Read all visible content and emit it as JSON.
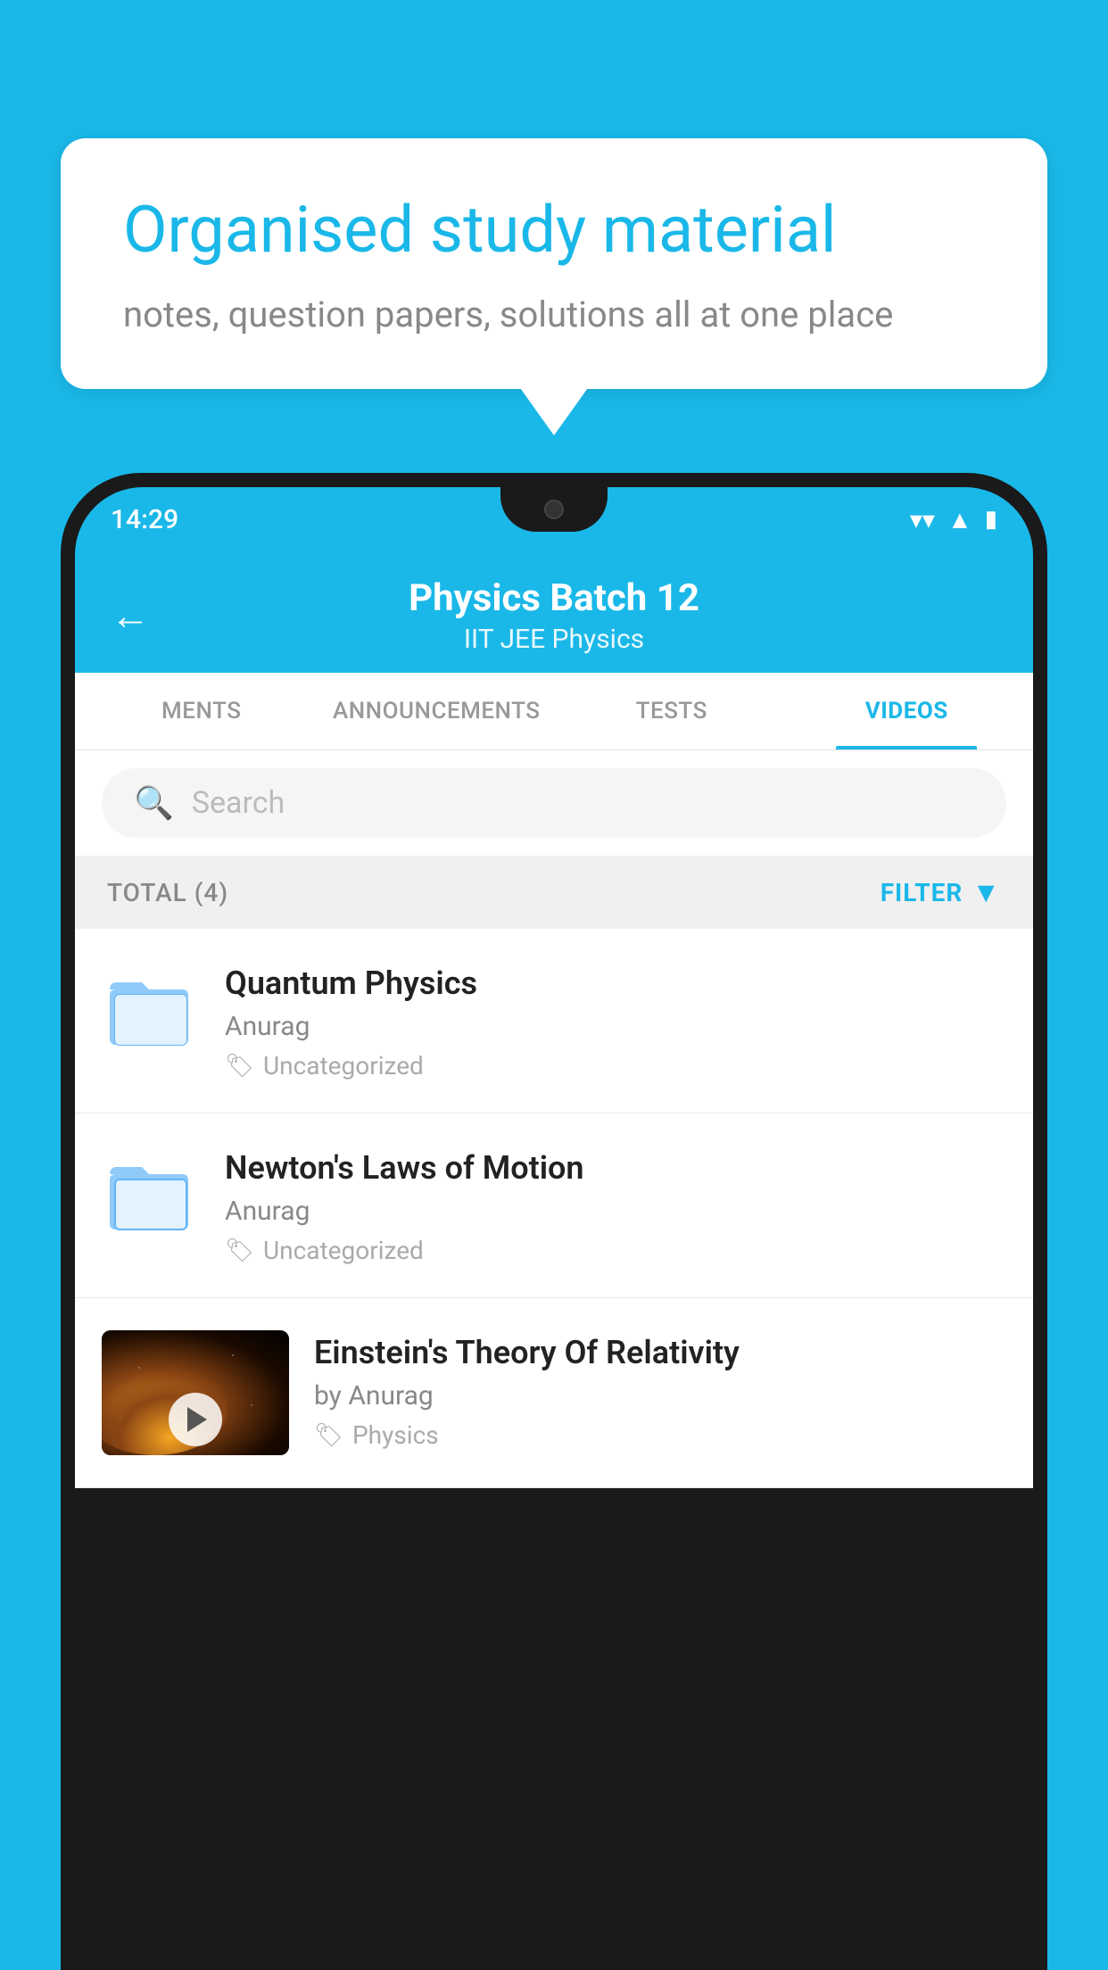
{
  "bubble": {
    "title": "Organised study material",
    "subtitle": "notes, question papers, solutions all at one place"
  },
  "statusBar": {
    "time": "14:29"
  },
  "appHeader": {
    "title": "Physics Batch 12",
    "subtitle": "IIT JEE   Physics",
    "backLabel": "←"
  },
  "tabs": [
    {
      "label": "MENTS",
      "active": false
    },
    {
      "label": "ANNOUNCEMENTS",
      "active": false
    },
    {
      "label": "TESTS",
      "active": false
    },
    {
      "label": "VIDEOS",
      "active": true
    }
  ],
  "search": {
    "placeholder": "Search"
  },
  "filterBar": {
    "total": "TOTAL (4)",
    "filterLabel": "FILTER"
  },
  "videos": [
    {
      "title": "Quantum Physics",
      "author": "Anurag",
      "tag": "Uncategorized",
      "type": "folder"
    },
    {
      "title": "Newton's Laws of Motion",
      "author": "Anurag",
      "tag": "Uncategorized",
      "type": "folder"
    },
    {
      "title": "Einstein's Theory Of Relativity",
      "author": "by Anurag",
      "tag": "Physics",
      "type": "video"
    }
  ],
  "colors": {
    "accent": "#1ab8e8",
    "textDark": "#222",
    "textMid": "#888",
    "textLight": "#aaa"
  }
}
